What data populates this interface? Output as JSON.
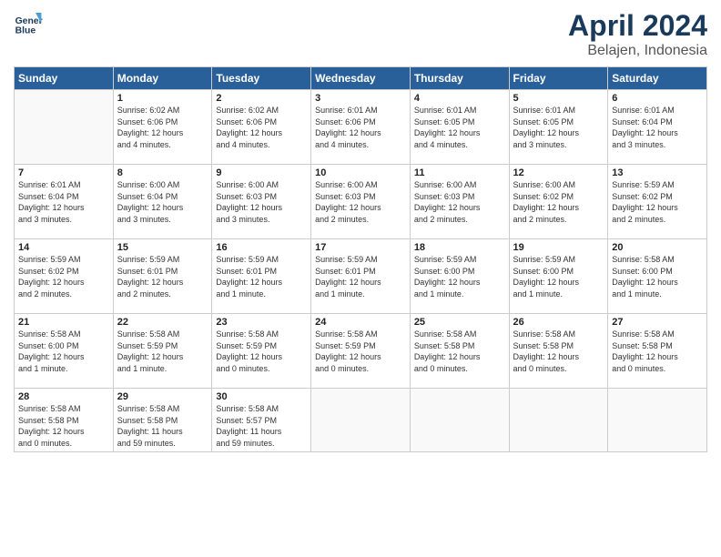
{
  "header": {
    "logo_line1": "General",
    "logo_line2": "Blue",
    "month": "April 2024",
    "location": "Belajen, Indonesia"
  },
  "days_of_week": [
    "Sunday",
    "Monday",
    "Tuesday",
    "Wednesday",
    "Thursday",
    "Friday",
    "Saturday"
  ],
  "weeks": [
    [
      {
        "day": "",
        "info": ""
      },
      {
        "day": "1",
        "info": "Sunrise: 6:02 AM\nSunset: 6:06 PM\nDaylight: 12 hours\nand 4 minutes."
      },
      {
        "day": "2",
        "info": "Sunrise: 6:02 AM\nSunset: 6:06 PM\nDaylight: 12 hours\nand 4 minutes."
      },
      {
        "day": "3",
        "info": "Sunrise: 6:01 AM\nSunset: 6:06 PM\nDaylight: 12 hours\nand 4 minutes."
      },
      {
        "day": "4",
        "info": "Sunrise: 6:01 AM\nSunset: 6:05 PM\nDaylight: 12 hours\nand 4 minutes."
      },
      {
        "day": "5",
        "info": "Sunrise: 6:01 AM\nSunset: 6:05 PM\nDaylight: 12 hours\nand 3 minutes."
      },
      {
        "day": "6",
        "info": "Sunrise: 6:01 AM\nSunset: 6:04 PM\nDaylight: 12 hours\nand 3 minutes."
      }
    ],
    [
      {
        "day": "7",
        "info": "Sunrise: 6:01 AM\nSunset: 6:04 PM\nDaylight: 12 hours\nand 3 minutes."
      },
      {
        "day": "8",
        "info": "Sunrise: 6:00 AM\nSunset: 6:04 PM\nDaylight: 12 hours\nand 3 minutes."
      },
      {
        "day": "9",
        "info": "Sunrise: 6:00 AM\nSunset: 6:03 PM\nDaylight: 12 hours\nand 3 minutes."
      },
      {
        "day": "10",
        "info": "Sunrise: 6:00 AM\nSunset: 6:03 PM\nDaylight: 12 hours\nand 2 minutes."
      },
      {
        "day": "11",
        "info": "Sunrise: 6:00 AM\nSunset: 6:03 PM\nDaylight: 12 hours\nand 2 minutes."
      },
      {
        "day": "12",
        "info": "Sunrise: 6:00 AM\nSunset: 6:02 PM\nDaylight: 12 hours\nand 2 minutes."
      },
      {
        "day": "13",
        "info": "Sunrise: 5:59 AM\nSunset: 6:02 PM\nDaylight: 12 hours\nand 2 minutes."
      }
    ],
    [
      {
        "day": "14",
        "info": "Sunrise: 5:59 AM\nSunset: 6:02 PM\nDaylight: 12 hours\nand 2 minutes."
      },
      {
        "day": "15",
        "info": "Sunrise: 5:59 AM\nSunset: 6:01 PM\nDaylight: 12 hours\nand 2 minutes."
      },
      {
        "day": "16",
        "info": "Sunrise: 5:59 AM\nSunset: 6:01 PM\nDaylight: 12 hours\nand 1 minute."
      },
      {
        "day": "17",
        "info": "Sunrise: 5:59 AM\nSunset: 6:01 PM\nDaylight: 12 hours\nand 1 minute."
      },
      {
        "day": "18",
        "info": "Sunrise: 5:59 AM\nSunset: 6:00 PM\nDaylight: 12 hours\nand 1 minute."
      },
      {
        "day": "19",
        "info": "Sunrise: 5:59 AM\nSunset: 6:00 PM\nDaylight: 12 hours\nand 1 minute."
      },
      {
        "day": "20",
        "info": "Sunrise: 5:58 AM\nSunset: 6:00 PM\nDaylight: 12 hours\nand 1 minute."
      }
    ],
    [
      {
        "day": "21",
        "info": "Sunrise: 5:58 AM\nSunset: 6:00 PM\nDaylight: 12 hours\nand 1 minute."
      },
      {
        "day": "22",
        "info": "Sunrise: 5:58 AM\nSunset: 5:59 PM\nDaylight: 12 hours\nand 1 minute."
      },
      {
        "day": "23",
        "info": "Sunrise: 5:58 AM\nSunset: 5:59 PM\nDaylight: 12 hours\nand 0 minutes."
      },
      {
        "day": "24",
        "info": "Sunrise: 5:58 AM\nSunset: 5:59 PM\nDaylight: 12 hours\nand 0 minutes."
      },
      {
        "day": "25",
        "info": "Sunrise: 5:58 AM\nSunset: 5:58 PM\nDaylight: 12 hours\nand 0 minutes."
      },
      {
        "day": "26",
        "info": "Sunrise: 5:58 AM\nSunset: 5:58 PM\nDaylight: 12 hours\nand 0 minutes."
      },
      {
        "day": "27",
        "info": "Sunrise: 5:58 AM\nSunset: 5:58 PM\nDaylight: 12 hours\nand 0 minutes."
      }
    ],
    [
      {
        "day": "28",
        "info": "Sunrise: 5:58 AM\nSunset: 5:58 PM\nDaylight: 12 hours\nand 0 minutes."
      },
      {
        "day": "29",
        "info": "Sunrise: 5:58 AM\nSunset: 5:58 PM\nDaylight: 11 hours\nand 59 minutes."
      },
      {
        "day": "30",
        "info": "Sunrise: 5:58 AM\nSunset: 5:57 PM\nDaylight: 11 hours\nand 59 minutes."
      },
      {
        "day": "",
        "info": ""
      },
      {
        "day": "",
        "info": ""
      },
      {
        "day": "",
        "info": ""
      },
      {
        "day": "",
        "info": ""
      }
    ]
  ]
}
